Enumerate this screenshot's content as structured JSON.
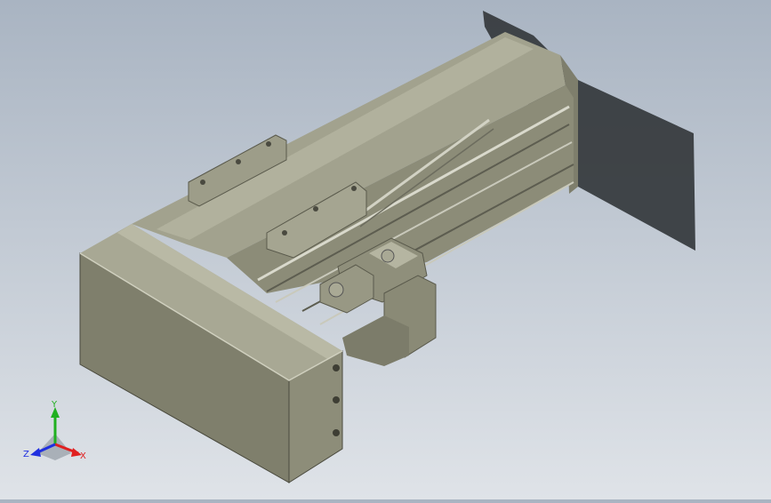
{
  "viewport": {
    "background_top": "#a9b4c2",
    "background_bottom": "#dfe3e8",
    "model_color": "#8c8c78",
    "shadow_color": "#3a3e42"
  },
  "triad": {
    "x_label": "X",
    "y_label": "Y",
    "z_label": "Z",
    "x_color": "#e02020",
    "y_color": "#20b020",
    "z_color": "#2030e0"
  }
}
